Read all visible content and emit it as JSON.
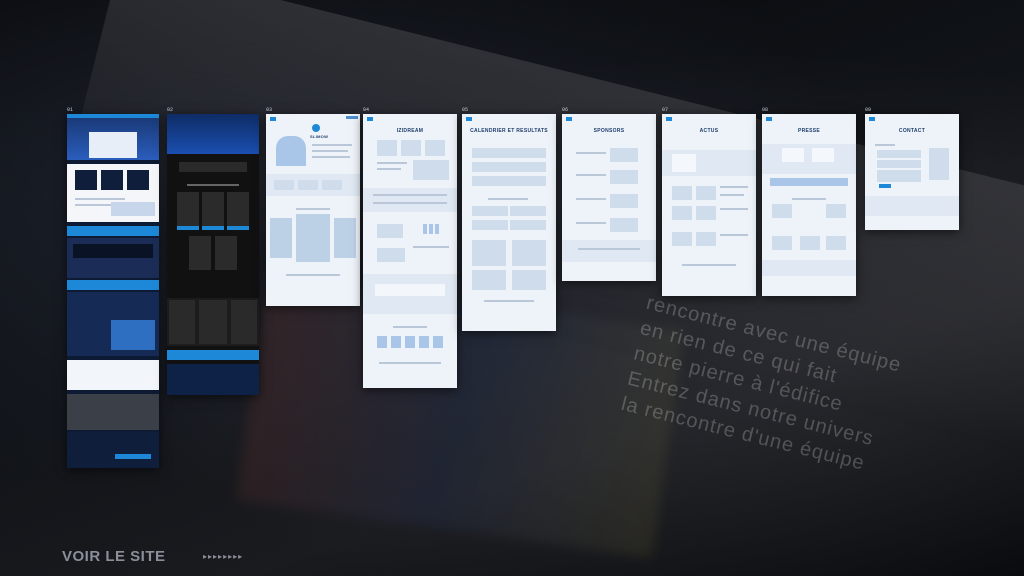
{
  "boards": [
    {
      "label": "01",
      "title": ""
    },
    {
      "label": "02",
      "title": ""
    },
    {
      "label": "03",
      "title": "SLIMOW"
    },
    {
      "label": "04",
      "title": "IZIDREAM"
    },
    {
      "label": "05",
      "title": "CALENDRIER ET RESULTATS"
    },
    {
      "label": "06",
      "title": "SPONSORS"
    },
    {
      "label": "07",
      "title": "ACTUS"
    },
    {
      "label": "08",
      "title": "PRESSE"
    },
    {
      "label": "09",
      "title": "CONTACT"
    }
  ],
  "background_text": [
    "rencontre avec une équipe",
    "en rien de ce qui fait",
    "notre pierre à l'édifice",
    "Entrez dans notre univers",
    "la rencontre d'une équipe"
  ],
  "cta": {
    "label": "VOIR LE SITE",
    "arrows": "▸▸▸▸▸▸▸▸"
  },
  "colors": {
    "accent": "#1e88d8",
    "wireframe": "#eef3f9",
    "dark_navy": "#0d1a33"
  }
}
